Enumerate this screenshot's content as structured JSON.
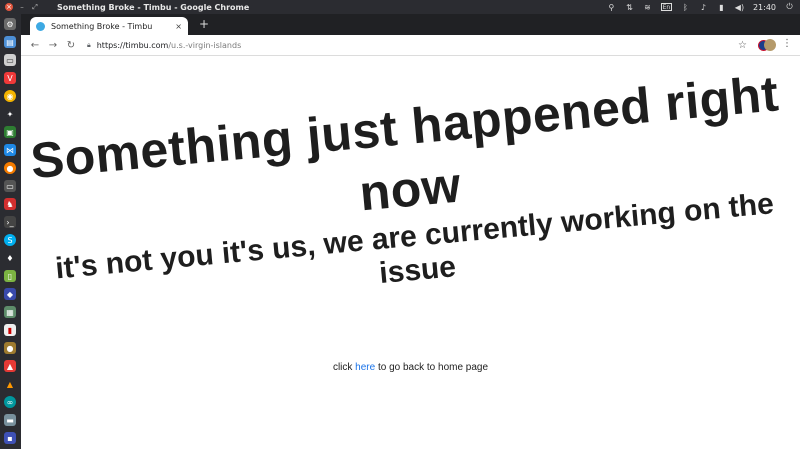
{
  "window": {
    "title": "Something Broke - Timbu - Google Chrome"
  },
  "system_tray": {
    "keyboard_layout": "En",
    "time": "21:40"
  },
  "browser": {
    "tab": {
      "title": "Something Broke - Timbu",
      "close_glyph": "×"
    },
    "new_tab_glyph": "+",
    "url": {
      "host": "https://timbu.com",
      "path": "/u.s.-virgin-islands"
    }
  },
  "page": {
    "headline": "Something just happened right now",
    "subline": "it's not you it's us, we are currently working on the issue",
    "back_prefix": "click ",
    "back_link": "here",
    "back_suffix": " to go back to home page"
  },
  "icons": {
    "dock": [
      "settings-icon",
      "files-icon",
      "text-editor-icon",
      "vivaldi-icon",
      "chrome-icon",
      "app-icon",
      "terminal-icon",
      "vscode-icon",
      "firefox-icon",
      "monitor-icon",
      "game-icon",
      "terminal-icon",
      "skype-icon",
      "app-icon",
      "android-icon",
      "app-icon",
      "app-icon",
      "document-icon",
      "app-icon",
      "app-icon",
      "vlc-icon",
      "arduino-icon",
      "folder-icon",
      "app-icon"
    ]
  },
  "colors": {
    "link": "#1a73e8",
    "favicon": "#3da9e3"
  }
}
